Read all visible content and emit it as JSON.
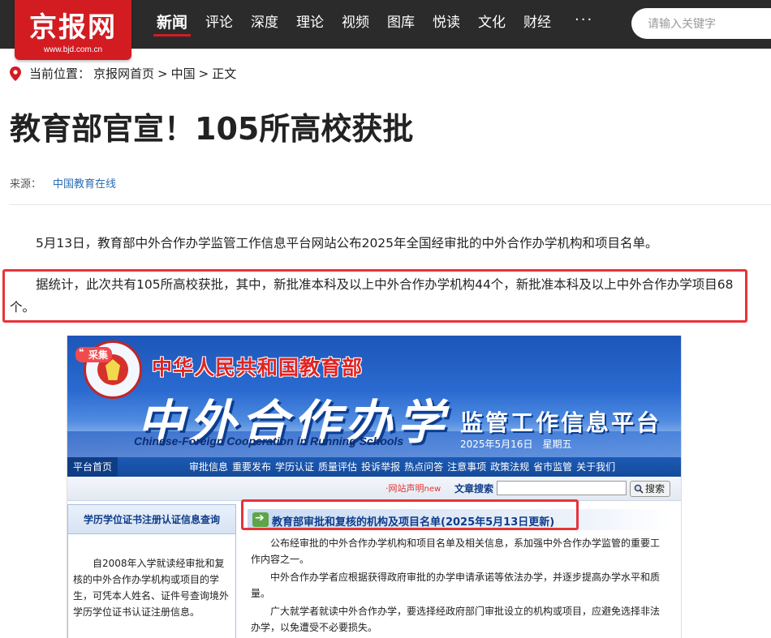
{
  "site": {
    "logo_text": "京报网",
    "logo_url": "www.bjd.com.cn",
    "nav": [
      "新闻",
      "评论",
      "深度",
      "理论",
      "视频",
      "图库",
      "悦读",
      "文化",
      "财经"
    ],
    "nav_more": "···",
    "search_placeholder": "请输入关键字",
    "accent_color": "#d21c22"
  },
  "breadcrumb": {
    "prefix": "当前位置：",
    "items": [
      "京报网首页",
      ">",
      "中国",
      ">",
      "正文"
    ]
  },
  "article": {
    "title": "教育部官宣！105所高校获批",
    "source_label": "来源：",
    "source_name": "中国教育在线",
    "paragraphs": [
      "5月13日，教育部中外合作办学监管工作信息平台网站公布2025年全国经审批的中外合作办学机构和项目名单。",
      "据统计，此次共有105所高校获批，其中，新批准本科及以上中外合作办学机构44个，新批准本科及以上中外合作办学项目68个。"
    ]
  },
  "screenshot": {
    "badge": "采集",
    "ministry": "中华人民共和国教育部",
    "big_title": "中外合作办学",
    "english": "Chinese-Foreign Cooperation in Running Schools",
    "platform": "监管工作信息平台",
    "date": "2025年5月16日　星期五",
    "menu_home": "平台首页",
    "menu_items": [
      "审批信息",
      "重要发布",
      "学历认证",
      "质量评估",
      "投诉举报",
      "热点问答",
      "注意事项",
      "政策法规",
      "省市监管",
      "关于我们"
    ],
    "statement": "·网站声明",
    "statement_new": "new",
    "search_label": "文章搜索",
    "search_button": "搜索",
    "sidebar_title": "学历学位证书注册认证信息查询",
    "sidebar_text": "自2008年入学就读经审批和复核的中外合作办学机构或项目的学生，可凭本人姓名、证件号查询境外学历学位证书认证注册信息。",
    "section_title": "教育部审批和复核的机构及项目名单(2025年5月13日更新)",
    "body": [
      "公布经审批的中外合作办学机构和项目名单及相关信息，系加强中外合作办学监管的重要工作内容之一。",
      "中外合作办学者应根据获得政府审批的办学申请承诺等依法办学，并逐步提高办学水平和质量。",
      "广大就学者就读中外合作办学，要选择经政府部门审批设立的机构或项目，应避免选择非法办学，以免遭受不必要损失。"
    ]
  }
}
